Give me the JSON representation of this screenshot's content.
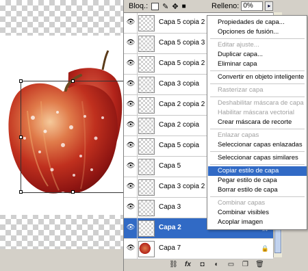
{
  "toolbar": {
    "lock_label": "Bloq.:",
    "fill_label": "Relleno:",
    "fill_value": "0%",
    "fill_arrow": "▸"
  },
  "layers": [
    {
      "name": "Capa 5 copia 2"
    },
    {
      "name": "Capa 5 copia 3"
    },
    {
      "name": "Capa 5 copia 2"
    },
    {
      "name": "Capa 3 copia"
    },
    {
      "name": "Capa 2 copia 2"
    },
    {
      "name": "Capa 2 copia"
    },
    {
      "name": "Capa 5 copia"
    },
    {
      "name": "Capa 5"
    },
    {
      "name": "Capa 3 copia 2"
    },
    {
      "name": "Capa 3"
    },
    {
      "name": "Capa 2",
      "selected": true
    },
    {
      "name": "Capa 7"
    }
  ],
  "menu": {
    "items": [
      {
        "label": "Propiedades de capa...",
        "state": "enabled"
      },
      {
        "label": "Opciones de fusión...",
        "state": "enabled"
      },
      {
        "label": "Editar ajuste...",
        "state": "disabled"
      },
      {
        "label": "Duplicar capa...",
        "state": "enabled"
      },
      {
        "label": "Eliminar capa",
        "state": "enabled"
      },
      {
        "label": "Convertir en objeto inteligente",
        "state": "enabled"
      },
      {
        "label": "Rasterizar capa",
        "state": "disabled"
      },
      {
        "label": "Deshabilitar máscara de capa",
        "state": "disabled"
      },
      {
        "label": "Habilitar máscara vectorial",
        "state": "disabled"
      },
      {
        "label": "Crear máscara de recorte",
        "state": "enabled"
      },
      {
        "label": "Enlazar capas",
        "state": "disabled"
      },
      {
        "label": "Seleccionar capas enlazadas",
        "state": "enabled"
      },
      {
        "label": "Seleccionar capas similares",
        "state": "enabled"
      },
      {
        "label": "Copiar estilo de capa",
        "state": "hover"
      },
      {
        "label": "Pegar estilo de capa",
        "state": "enabled"
      },
      {
        "label": "Borrar estilo de capa",
        "state": "enabled"
      },
      {
        "label": "Combinar capas",
        "state": "disabled"
      },
      {
        "label": "Combinar visibles",
        "state": "enabled"
      },
      {
        "label": "Acoplar imagen",
        "state": "enabled"
      }
    ]
  },
  "icons": {
    "eye": "eye-icon",
    "link": "link-icon",
    "fx": "fx-icon",
    "mask": "add-mask-icon",
    "adjust": "adjustment-layer-icon",
    "folder": "new-group-icon",
    "new": "new-layer-icon",
    "trash": "delete-layer-icon"
  },
  "colors": {
    "selection": "#316ac5",
    "panel": "#d4d0c8"
  }
}
